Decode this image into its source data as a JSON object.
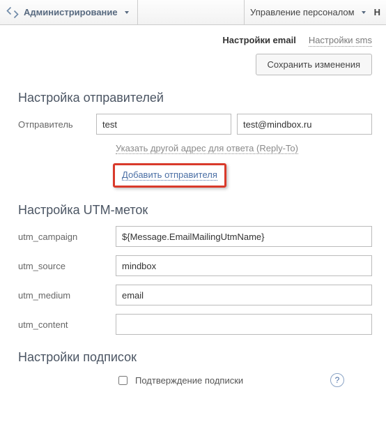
{
  "topbar": {
    "admin": "Администрирование",
    "right_menu": "Управление персоналом",
    "trailing": "Н"
  },
  "tabs": {
    "email": "Настройки email",
    "sms": "Настройки sms"
  },
  "buttons": {
    "save": "Сохранить изменения"
  },
  "senders": {
    "heading": "Настройка отправителей",
    "label": "Отправитель",
    "name": "test",
    "email": "test@mindbox.ru",
    "reply_to": "Указать другой адрес для ответа (Reply-To)",
    "add": "Добавить отправителя"
  },
  "utm": {
    "heading": "Настройка UTM-меток",
    "campaign_label": "utm_campaign",
    "campaign_value": "${Message.EmailMailingUtmName}",
    "source_label": "utm_source",
    "source_value": "mindbox",
    "medium_label": "utm_medium",
    "medium_value": "email",
    "content_label": "utm_content",
    "content_value": ""
  },
  "subs": {
    "heading": "Настройки подписок",
    "confirm_label": "Подтверждение подписки"
  }
}
